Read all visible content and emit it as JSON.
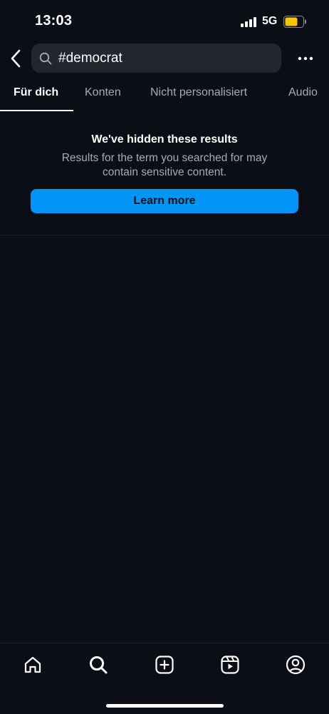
{
  "status_bar": {
    "time": "13:03",
    "network": "5G",
    "battery_color": "#f7c600"
  },
  "search": {
    "query": "#democrat"
  },
  "tabs": [
    {
      "label": "Für dich",
      "active": true
    },
    {
      "label": "Konten",
      "active": false
    },
    {
      "label": "Nicht personalisiert",
      "active": false
    },
    {
      "label": "Audio",
      "active": false
    }
  ],
  "notice": {
    "title": "We've hidden these results",
    "body": "Results for the term you searched for may contain sensitive content.",
    "button_label": "Learn more",
    "button_color": "#0095f6"
  },
  "bottom_nav": {
    "items": [
      "home-icon",
      "search-icon",
      "create-icon",
      "reels-icon",
      "profile-icon"
    ],
    "active": "search-icon"
  },
  "theme": {
    "background": "#0b0e16",
    "surface": "#23262e",
    "secondary_text": "#a8abb3"
  }
}
